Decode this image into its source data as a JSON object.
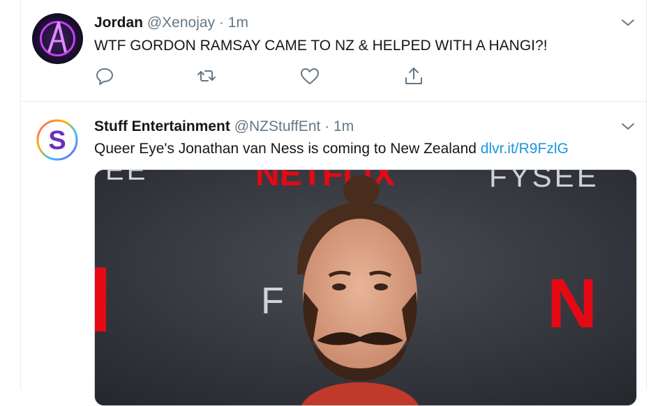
{
  "tweets": [
    {
      "name": "Jordan",
      "handle": "@Xenojay",
      "dot": "·",
      "time": "1m",
      "text": "WTF GORDON RAMSAY CAME TO NZ & HELPED WITH A HANGI?!"
    },
    {
      "name": "Stuff Entertainment",
      "handle": "@NZStuffEnt",
      "dot": "·",
      "time": "1m",
      "text": "Queer Eye's Jonathan van Ness is coming to New Zealand ",
      "link": "dlvr.it/R9FzlG",
      "avatar_letter": "S",
      "media_texts": {
        "top": "NETFLIX",
        "fysee_right": "FYSEE",
        "fysee_left": "EE",
        "mid_left": "F",
        "n_right": "N"
      }
    }
  ],
  "colors": {
    "icon_gray": "#657786",
    "link_blue": "#1b95e0",
    "netflix_red": "#e50914"
  },
  "icons": [
    "reply-icon",
    "retweet-icon",
    "like-icon",
    "share-icon",
    "chevron-down-icon"
  ]
}
